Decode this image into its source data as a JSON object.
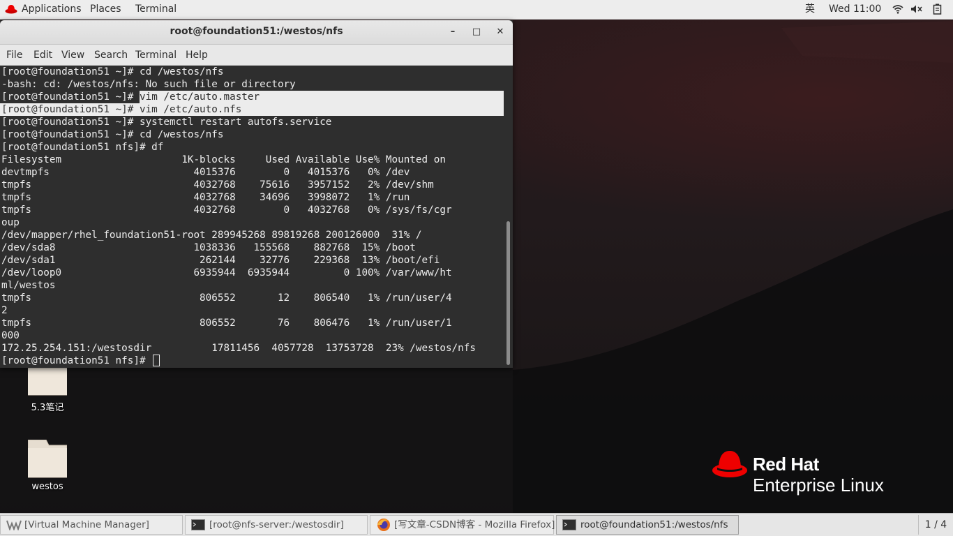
{
  "topbar": {
    "applications": "Applications",
    "places": "Places",
    "terminal": "Terminal",
    "input_method": "英",
    "clock": "Wed 11:00"
  },
  "window": {
    "title": "root@foundation51:/westos/nfs",
    "minimize": "–",
    "maximize": "□",
    "close": "✕",
    "menu": [
      "File",
      "Edit",
      "View",
      "Search",
      "Terminal",
      "Help"
    ]
  },
  "terminal_lines": [
    "[root@foundation51 ~]# cd /westos/nfs",
    "-bash: cd: /westos/nfs: No such file or directory",
    "[root@foundation51 ~]# vim /etc/auto.master",
    "[root@foundation51 ~]# vim /etc/auto.nfs",
    "[root@foundation51 ~]# systemctl restart autofs.service",
    "[root@foundation51 ~]# cd /westos/nfs",
    "[root@foundation51 nfs]# df",
    "Filesystem                    1K-blocks     Used Available Use% Mounted on",
    "devtmpfs                        4015376        0   4015376   0% /dev",
    "tmpfs                           4032768    75616   3957152   2% /dev/shm",
    "tmpfs                           4032768    34696   3998072   1% /run",
    "tmpfs                           4032768        0   4032768   0% /sys/fs/cgr",
    "oup",
    "/dev/mapper/rhel_foundation51-root 289945268 89819268 200126000  31% /",
    "/dev/sda8                       1038336   155568    882768  15% /boot",
    "/dev/sda1                        262144    32776    229368  13% /boot/efi",
    "/dev/loop0                      6935944  6935944         0 100% /var/www/ht",
    "ml/westos",
    "tmpfs                            806552       12    806540   1% /run/user/4",
    "2",
    "tmpfs                            806552       76    806476   1% /run/user/1",
    "000",
    "172.25.254.151:/westosdir          17811456  4057728  13753728  23% /westos/nfs",
    "[root@foundation51 nfs]# "
  ],
  "desktop_icons": [
    {
      "label": "5.3笔记",
      "icon": "folder-icon"
    },
    {
      "label": "westos",
      "icon": "folder-icon"
    }
  ],
  "branding": {
    "line1": "Red Hat",
    "line2": "Enterprise Linux"
  },
  "taskbar": {
    "tasks": [
      {
        "label": "[Virtual Machine Manager]",
        "icon": "vmm-icon"
      },
      {
        "label": "[root@nfs-server:/westosdir]",
        "icon": "terminal-icon"
      },
      {
        "label": "[写文章-CSDN博客 - Mozilla Firefox]",
        "icon": "firefox-icon"
      },
      {
        "label": "root@foundation51:/westos/nfs",
        "icon": "terminal-icon"
      }
    ],
    "workspace": "1 / 4"
  }
}
